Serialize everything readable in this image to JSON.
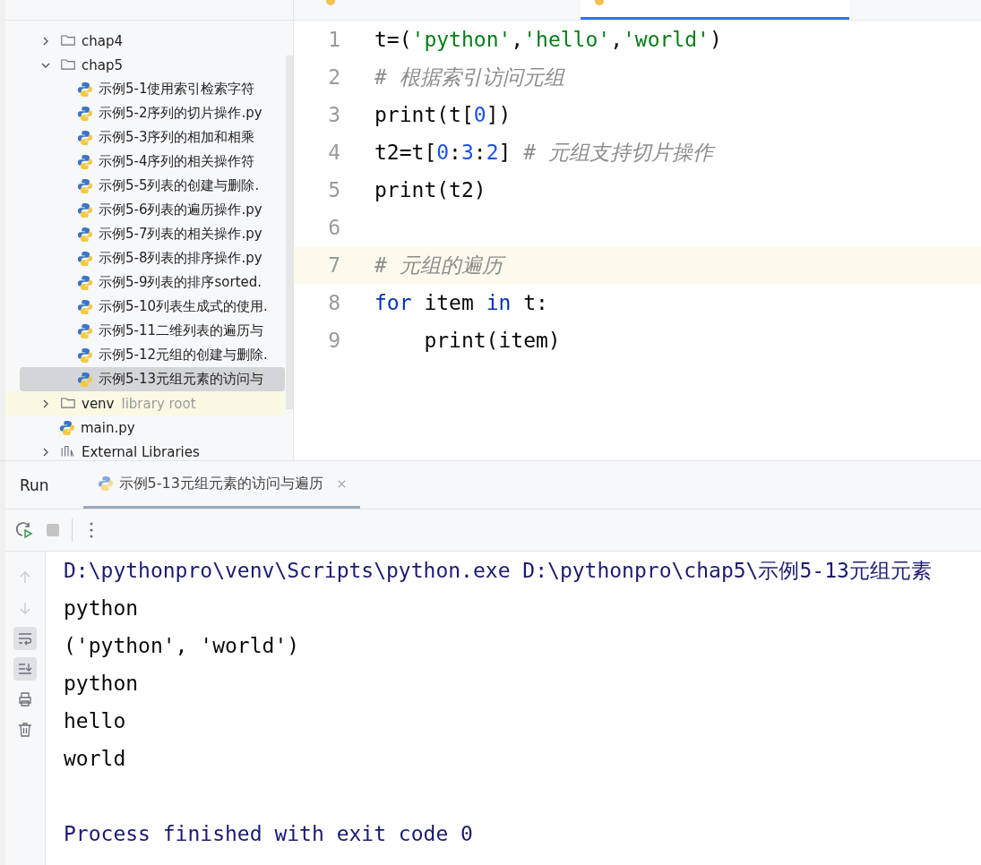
{
  "editor_tabs": [
    {
      "selected": false
    },
    {
      "selected": true
    }
  ],
  "project_tree": [
    {
      "label": "chap4",
      "kind": "folder",
      "expanded": false,
      "selected": false
    },
    {
      "label": "chap5",
      "kind": "folder",
      "expanded": true,
      "selected": false,
      "children": [
        {
          "label": "示例5-1使用索引检索字符",
          "kind": "python",
          "selected": false
        },
        {
          "label": "示例5-2序列的切片操作.py",
          "kind": "python",
          "selected": false
        },
        {
          "label": "示例5-3序列的相加和相乘",
          "kind": "python",
          "selected": false
        },
        {
          "label": "示例5-4序列的相关操作符",
          "kind": "python",
          "selected": false
        },
        {
          "label": "示例5-5列表的创建与删除.",
          "kind": "python",
          "selected": false
        },
        {
          "label": "示例5-6列表的遍历操作.py",
          "kind": "python",
          "selected": false
        },
        {
          "label": "示例5-7列表的相关操作.py",
          "kind": "python",
          "selected": false
        },
        {
          "label": "示例5-8列表的排序操作.py",
          "kind": "python",
          "selected": false
        },
        {
          "label": "示例5-9列表的排序sorted.",
          "kind": "python",
          "selected": false
        },
        {
          "label": "示例5-10列表生成式的使用.",
          "kind": "python",
          "selected": false
        },
        {
          "label": "示例5-11二维列表的遍历与",
          "kind": "python",
          "selected": false
        },
        {
          "label": "示例5-12元组的创建与删除.",
          "kind": "python",
          "selected": false
        },
        {
          "label": "示例5-13元组元素的访问与",
          "kind": "python",
          "selected": true
        }
      ]
    },
    {
      "label": "venv",
      "kind": "folder",
      "expanded": false,
      "selected": false,
      "note": "library root"
    },
    {
      "label": "main.py",
      "kind": "python",
      "selected": false
    },
    {
      "label": "External Libraries",
      "kind": "library",
      "expanded": false,
      "selected": false
    }
  ],
  "code_lines": [
    {
      "number": "1",
      "current": false,
      "tokens": [
        {
          "kind": "plain",
          "text": "t=("
        },
        {
          "kind": "string",
          "text": "'python'"
        },
        {
          "kind": "plain",
          "text": ","
        },
        {
          "kind": "string",
          "text": "'hello'"
        },
        {
          "kind": "plain",
          "text": ","
        },
        {
          "kind": "string",
          "text": "'world'"
        },
        {
          "kind": "plain",
          "text": ")"
        }
      ]
    },
    {
      "number": "2",
      "current": false,
      "tokens": [
        {
          "kind": "comment",
          "text": "# 根据索引访问元组"
        }
      ]
    },
    {
      "number": "3",
      "current": false,
      "tokens": [
        {
          "kind": "plain",
          "text": "print(t["
        },
        {
          "kind": "number",
          "text": "0"
        },
        {
          "kind": "plain",
          "text": "])"
        }
      ]
    },
    {
      "number": "4",
      "current": false,
      "tokens": [
        {
          "kind": "plain",
          "text": "t2=t["
        },
        {
          "kind": "number",
          "text": "0"
        },
        {
          "kind": "plain",
          "text": ":"
        },
        {
          "kind": "number",
          "text": "3"
        },
        {
          "kind": "plain",
          "text": ":"
        },
        {
          "kind": "number",
          "text": "2"
        },
        {
          "kind": "plain",
          "text": "] "
        },
        {
          "kind": "comment",
          "text": "# 元组支持切片操作"
        }
      ]
    },
    {
      "number": "5",
      "current": false,
      "tokens": [
        {
          "kind": "plain",
          "text": "print(t2)"
        }
      ]
    },
    {
      "number": "6",
      "current": false
    },
    {
      "number": "7",
      "current": true,
      "tokens": [
        {
          "kind": "comment",
          "text": "# 元组的遍历"
        }
      ]
    },
    {
      "number": "8",
      "current": false,
      "tokens": [
        {
          "kind": "keyword",
          "text": "for"
        },
        {
          "kind": "plain",
          "text": " item "
        },
        {
          "kind": "keyword",
          "text": "in"
        },
        {
          "kind": "plain",
          "text": " t:"
        }
      ]
    },
    {
      "number": "9",
      "current": false,
      "tokens": [
        {
          "kind": "plain",
          "text": "    print(item)"
        }
      ]
    }
  ],
  "run_panel": {
    "title": "Run",
    "tabs": [
      {
        "label": "示例5-13元组元素的访问与遍历",
        "selected": true
      }
    ],
    "toolbar": [
      {
        "kind": "rerun",
        "disabled": false
      },
      {
        "kind": "stop",
        "disabled": true
      },
      {
        "kind": "more",
        "disabled": false
      }
    ],
    "side_actions": [
      {
        "kind": "up",
        "on": false,
        "disabled": true
      },
      {
        "kind": "down",
        "on": false,
        "disabled": true
      },
      {
        "kind": "wrap",
        "on": true,
        "disabled": false
      },
      {
        "kind": "scroll-end",
        "on": true,
        "disabled": false
      },
      {
        "kind": "print",
        "on": false,
        "disabled": false
      },
      {
        "kind": "trash",
        "on": false,
        "disabled": false
      }
    ],
    "console": [
      {
        "kind": "command",
        "text": "D:\\pythonpro\\venv\\Scripts\\python.exe D:\\pythonpro\\chap5\\示例5-13元组元素"
      },
      {
        "kind": "output",
        "text": "python"
      },
      {
        "kind": "output",
        "text": "('python', 'world')"
      },
      {
        "kind": "output",
        "text": "python"
      },
      {
        "kind": "output",
        "text": "hello"
      },
      {
        "kind": "output",
        "text": "world"
      },
      {
        "kind": "exit",
        "text": "Process finished with exit code 0"
      }
    ]
  }
}
